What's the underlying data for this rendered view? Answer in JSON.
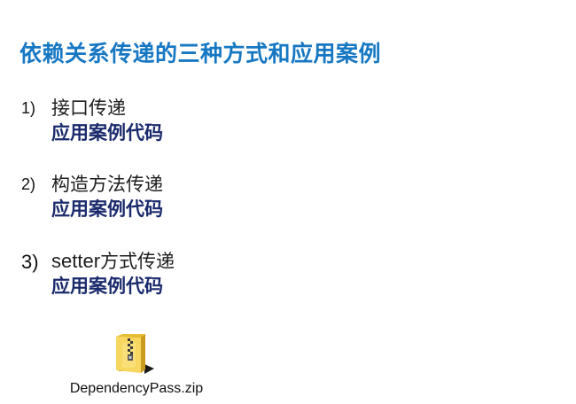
{
  "title": "依赖关系传递的三种方式和应用案例",
  "items": [
    {
      "number": "1)",
      "label": "接口传递",
      "link": "应用案例代码"
    },
    {
      "number": "2)",
      "label": "构造方法传递",
      "link": "应用案例代码"
    },
    {
      "number": "3)",
      "label_latin": "setter",
      "label": "方式传递",
      "link": "应用案例代码"
    }
  ],
  "attachment": {
    "icon": "zip-folder-icon",
    "filename": "DependencyPass.zip"
  },
  "colors": {
    "title": "#1677c3",
    "link": "#1a2a6c",
    "text": "#1e1e1e"
  }
}
